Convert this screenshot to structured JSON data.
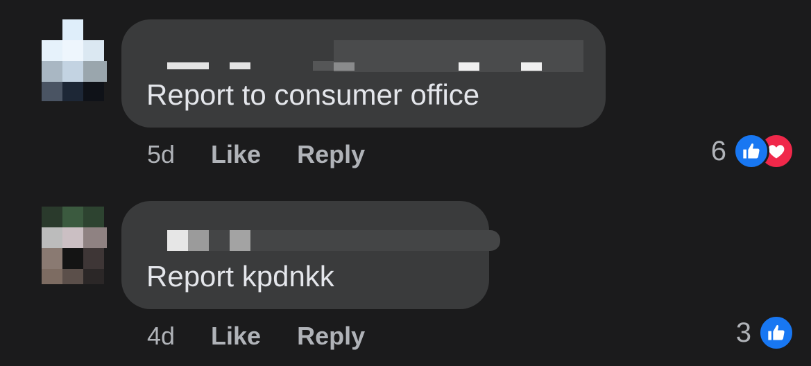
{
  "comments": [
    {
      "text": "Report to consumer office",
      "age": "5d",
      "like_label": "Like",
      "reply_label": "Reply",
      "reaction_count": "6",
      "reactions": [
        "like-icon",
        "love-icon"
      ]
    },
    {
      "text": "Report kpdnkk",
      "age": "4d",
      "like_label": "Like",
      "reply_label": "Reply",
      "reaction_count": "3",
      "reactions": [
        "like-icon"
      ]
    }
  ],
  "colors": {
    "background": "#1b1b1c",
    "bubble": "#3a3b3c",
    "text": "#e4e6eb",
    "secondary_text": "#b0b3b8",
    "like_blue": "#1877f2",
    "love_red": "#f0284a"
  }
}
